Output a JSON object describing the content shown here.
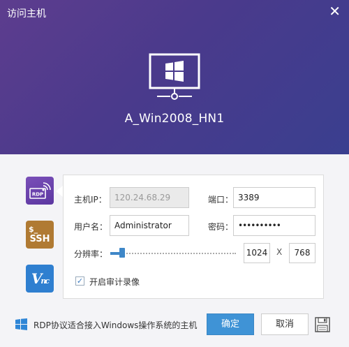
{
  "window": {
    "title": "访问主机"
  },
  "host": {
    "name": "A_Win2008_HN1"
  },
  "protocols": [
    {
      "label": "RDP",
      "icon": "rdp-icon",
      "active": true
    },
    {
      "label": "SSH",
      "sub": "$_",
      "icon": "ssh-icon",
      "active": false
    },
    {
      "label": "VNC",
      "icon": "vnc-icon",
      "active": false
    }
  ],
  "form": {
    "host_ip_label": "主机IP：",
    "host_ip_value": "120.24.68.29",
    "port_label": "端口：",
    "port_value": "3389",
    "username_label": "用户名：",
    "username_value": "Administrator",
    "password_label": "密码：",
    "password_value": "••••••••••",
    "resolution_label": "分辨率：",
    "resolution_width": "1024",
    "resolution_x": "X",
    "resolution_height": "768",
    "resolution_slider_fraction": 0.1,
    "audit_label": "开启审计录像",
    "audit_checked": true
  },
  "footer": {
    "note": "RDP协议适合接入Windows操作系统的主机",
    "ok_label": "确定",
    "cancel_label": "取消"
  },
  "colors": {
    "header_start": "#5d3d8e",
    "header_end": "#3a3f8f",
    "accent": "#3f93d6",
    "rdp": "#6b45b0",
    "ssh": "#b07a33",
    "vnc": "#2f7fd0"
  }
}
